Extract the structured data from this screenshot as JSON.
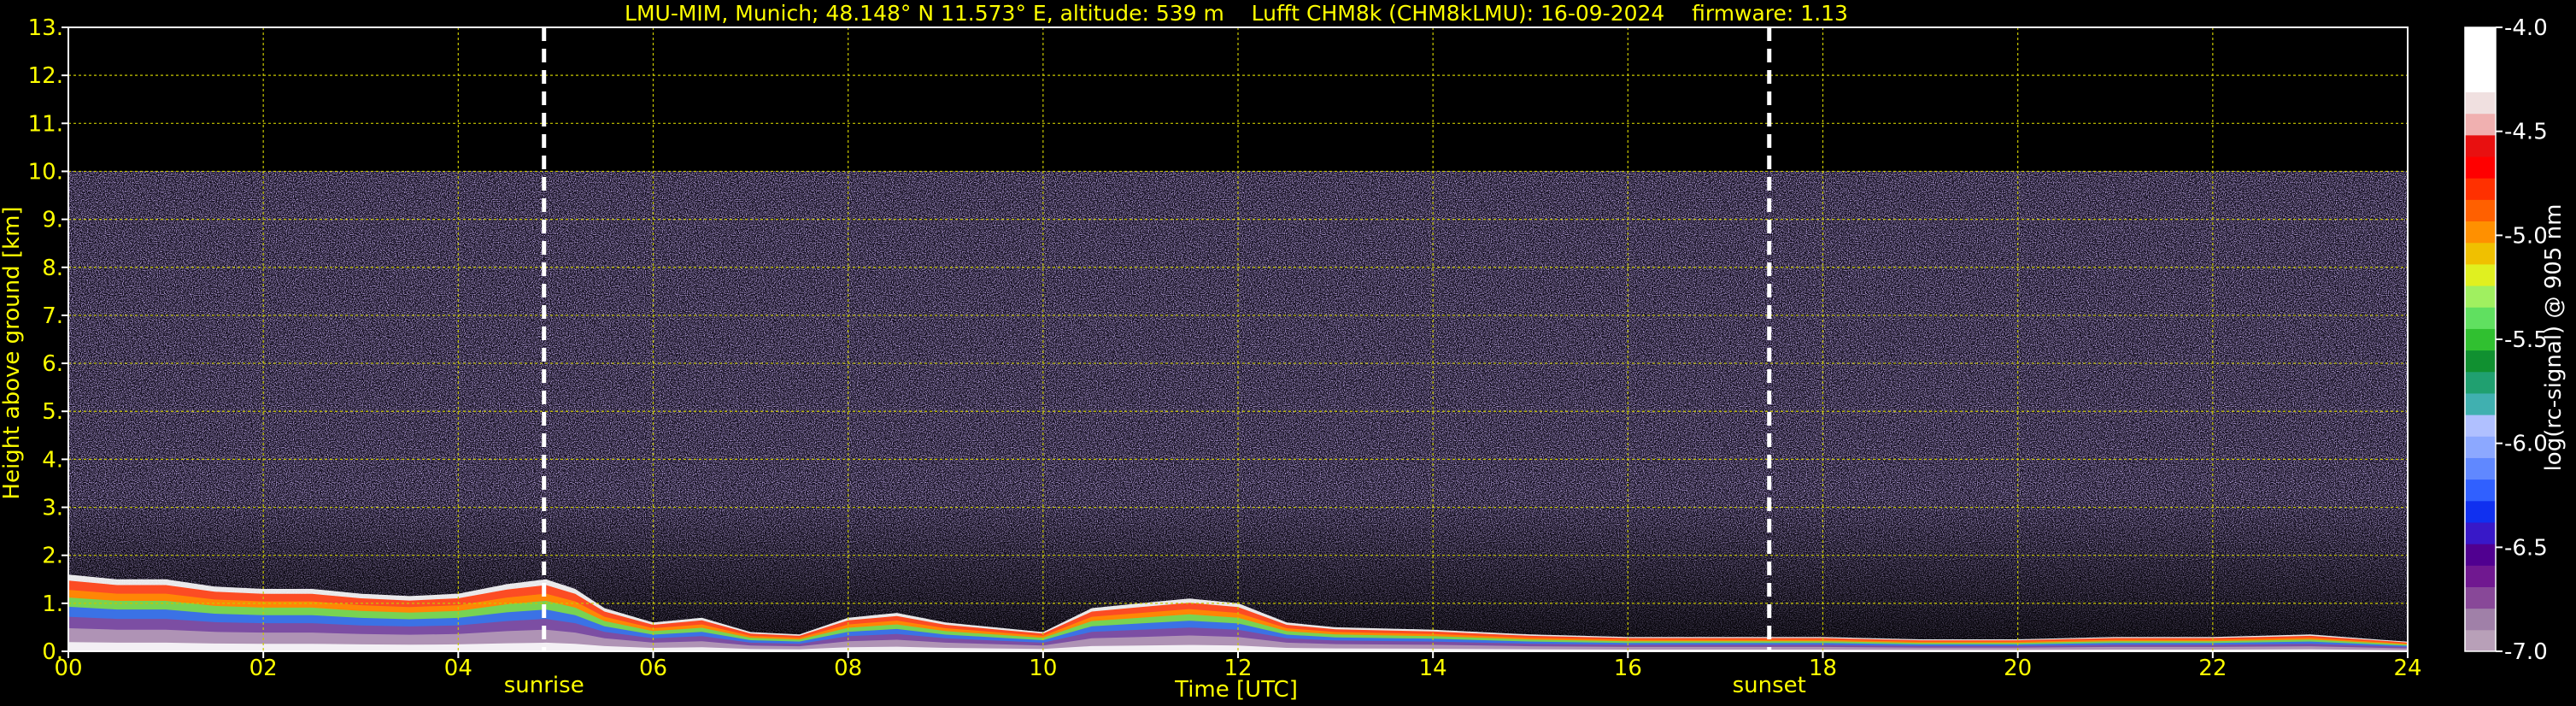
{
  "chart_data": {
    "type": "heatmap",
    "title": "LMU-MIM, Munich; 48.148° N 11.573° E, altitude: 539 m    Lufft CHM8k (CHM8kLMU): 16-09-2024    firmware: 1.13",
    "xlabel": "Time [UTC]",
    "ylabel": "Height above ground [km]",
    "xlim": [
      0,
      24
    ],
    "ylim": [
      0,
      13
    ],
    "x_ticks": [
      "00",
      "02",
      "04",
      "06",
      "08",
      "10",
      "12",
      "14",
      "16",
      "18",
      "20",
      "22",
      "24"
    ],
    "y_ticks": [
      "0.",
      "1.",
      "2.",
      "3.",
      "4.",
      "5.",
      "6.",
      "7.",
      "8.",
      "9.",
      "10.",
      "11.",
      "12.",
      "13."
    ],
    "grid": true,
    "signal_top_km": 10,
    "markers": [
      {
        "label": "sunrise",
        "time": 4.88
      },
      {
        "label": "sunset",
        "time": 17.45
      }
    ],
    "boundary_layer": {
      "time": [
        0,
        0.5,
        1,
        1.5,
        2,
        2.5,
        3,
        3.5,
        4,
        4.5,
        4.9,
        5.2,
        5.5,
        6,
        6.5,
        7,
        7.5,
        8,
        8.5,
        9,
        9.5,
        10,
        10.5,
        11,
        11.5,
        12,
        12.5,
        13,
        14,
        15,
        16,
        17,
        18,
        19,
        20,
        21,
        22,
        23,
        24
      ],
      "height_km": [
        1.6,
        1.5,
        1.5,
        1.35,
        1.3,
        1.3,
        1.2,
        1.15,
        1.2,
        1.4,
        1.5,
        1.3,
        0.9,
        0.6,
        0.7,
        0.4,
        0.35,
        0.7,
        0.8,
        0.6,
        0.5,
        0.4,
        0.9,
        1.0,
        1.1,
        1.0,
        0.6,
        0.5,
        0.45,
        0.35,
        0.3,
        0.3,
        0.3,
        0.25,
        0.25,
        0.3,
        0.3,
        0.35,
        0.2
      ]
    },
    "colorbar": {
      "label": "log(rc-signal) @ 905 nm",
      "range": [
        -7.0,
        -4.0
      ],
      "ticks": [
        "-4.0",
        "-4.5",
        "-5.0",
        "-5.5",
        "-6.0",
        "-6.5",
        "-7.0"
      ],
      "colors": [
        "#b8a0b8",
        "#a080a8",
        "#884898",
        "#701890",
        "#500090",
        "#3818c8",
        "#1030f0",
        "#3060ff",
        "#6088ff",
        "#8ca8ff",
        "#b0c0ff",
        "#40b0b0",
        "#20a070",
        "#109030",
        "#30c030",
        "#60e060",
        "#a0f060",
        "#e0f020",
        "#f0c000",
        "#ff9000",
        "#ff6000",
        "#ff3000",
        "#ff0000",
        "#e81010",
        "#f0b0b0",
        "#f0e0e0",
        "#ffffff",
        "#ffffff",
        "#ffffff"
      ]
    }
  }
}
